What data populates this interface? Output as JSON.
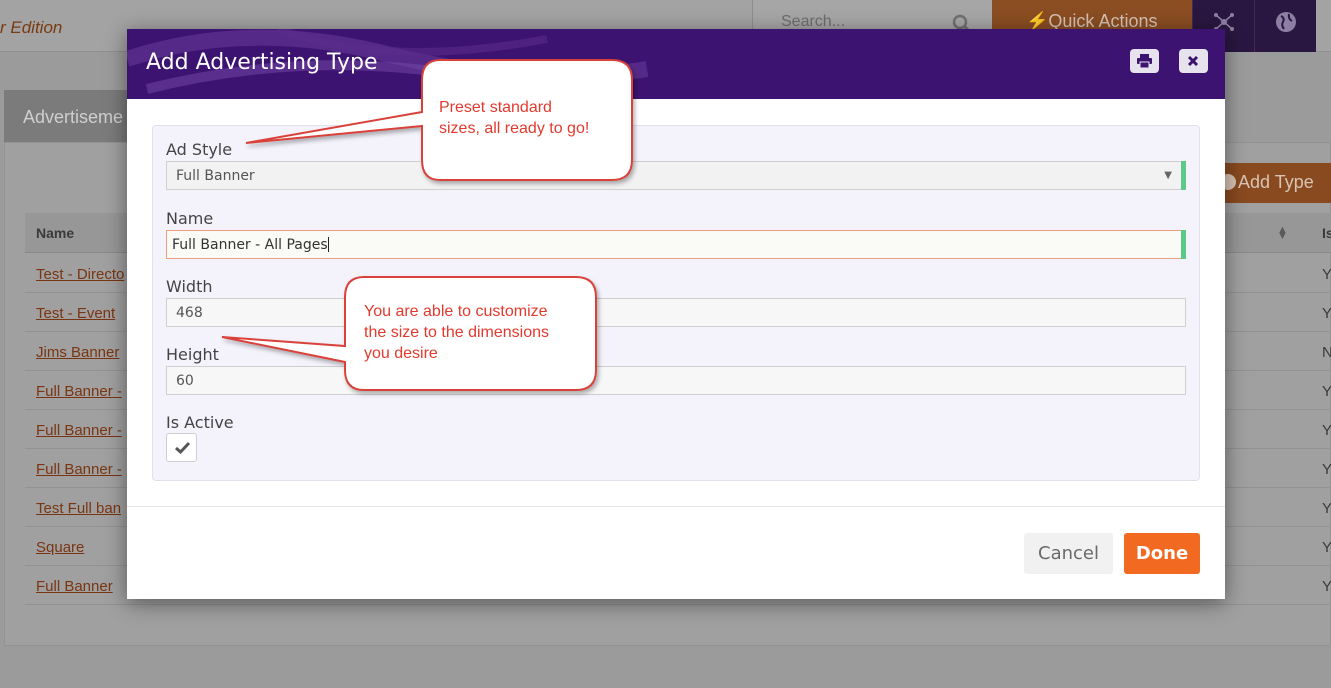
{
  "background": {
    "edition_text": "r Edition",
    "search_placeholder": "Search...",
    "quick_actions_label": "Quick Actions",
    "panel_tab_label": "Advertiseme",
    "add_type_label": "Add Type",
    "table": {
      "headers": {
        "name": "Name",
        "is_active": "Is"
      },
      "rows": [
        {
          "name": "Test - Directo",
          "active": "Y"
        },
        {
          "name": "Test - Event",
          "active": "Y"
        },
        {
          "name": "Jims Banner",
          "active": "N"
        },
        {
          "name": "Full Banner -",
          "active": "Y"
        },
        {
          "name": "Full Banner -",
          "active": "Y"
        },
        {
          "name": "Full Banner -",
          "active": "Y"
        },
        {
          "name": "Test Full ban",
          "active": "Y"
        },
        {
          "name": "Square",
          "active": "Y"
        },
        {
          "name": "Full Banner",
          "active": "Y"
        }
      ]
    }
  },
  "modal": {
    "title": "Add Advertising Type",
    "fields": {
      "ad_style": {
        "label": "Ad Style",
        "value": "Full Banner"
      },
      "name": {
        "label": "Name",
        "value": "Full Banner - All Pages"
      },
      "width": {
        "label": "Width",
        "value": "468"
      },
      "height": {
        "label": "Height",
        "value": "60"
      },
      "is_active": {
        "label": "Is Active",
        "checked": true
      }
    },
    "buttons": {
      "cancel": "Cancel",
      "done": "Done"
    }
  },
  "callouts": {
    "preset_line1": "Preset standard",
    "preset_line2": "sizes, all ready to go!",
    "custom_line1": "You are able to customize",
    "custom_line2": "the size to the dimensions",
    "custom_line3": "you desire"
  },
  "colors": {
    "modal_header": "#3c1370",
    "done_button": "#f26a21",
    "callout_red": "#e23a2e",
    "valid_green": "#5cc98a"
  },
  "icons": [
    "search-icon",
    "bolt-icon",
    "network-icon",
    "globe-icon",
    "print-icon",
    "close-icon",
    "check-icon",
    "chevron-down-icon",
    "plus-circle-icon",
    "sort-icon"
  ]
}
